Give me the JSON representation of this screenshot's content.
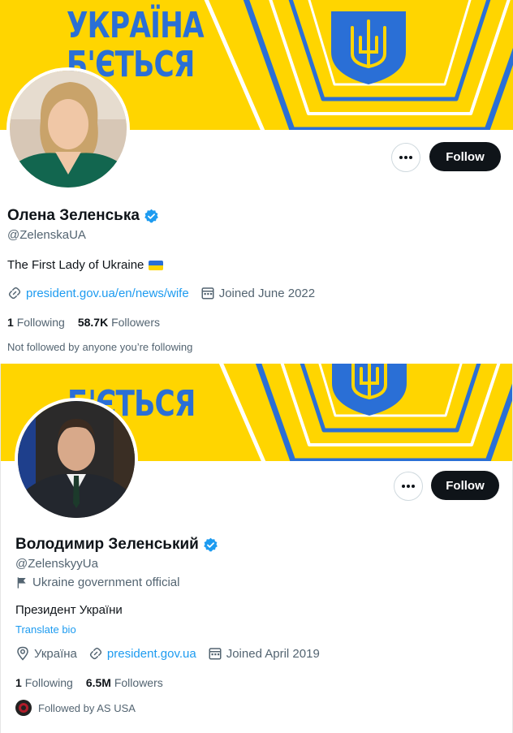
{
  "colors": {
    "banner_yellow": "#ffd500",
    "banner_blue": "#2a6fd6",
    "verified": "#1d9bf0",
    "link": "#1d9bf0",
    "follow_bg": "#0f1419"
  },
  "profiles": [
    {
      "banner_lines": [
        "УКРАЇНА",
        "Б'ЄТЬСЯ"
      ],
      "name": "Олена Зеленська",
      "handle": "@ZelenskaUA",
      "bio": "The First Lady of Ukraine",
      "link_text": "president.gov.ua/en/news/wife",
      "joined": "Joined June 2022",
      "following_count": "1",
      "following_label": "Following",
      "followers_count": "58.7K",
      "followers_label": "Followers",
      "followed_by": "Not followed by anyone you’re following",
      "follow_label": "Follow",
      "more_label": "···",
      "icons": [
        "link-icon",
        "calendar-icon",
        "verified-badge-icon",
        "more-icon",
        "ukraine-flag-icon"
      ]
    },
    {
      "banner_lines": [
        "Б'ЄТЬСЯ"
      ],
      "name": "Володимир Зеленський",
      "handle": "@ZelenskyyUa",
      "affiliation": "Ukraine government official",
      "bio": "Президент України",
      "translate_label": "Translate bio",
      "location": "Україна",
      "link_text": "president.gov.ua",
      "joined": "Joined April 2019",
      "following_count": "1",
      "following_label": "Following",
      "followers_count": "6.5M",
      "followers_label": "Followers",
      "followed_by": "Followed by AS USA",
      "follow_label": "Follow",
      "more_label": "···",
      "icons": [
        "location-icon",
        "link-icon",
        "calendar-icon",
        "flag-icon",
        "verified-badge-icon",
        "more-icon"
      ]
    }
  ]
}
